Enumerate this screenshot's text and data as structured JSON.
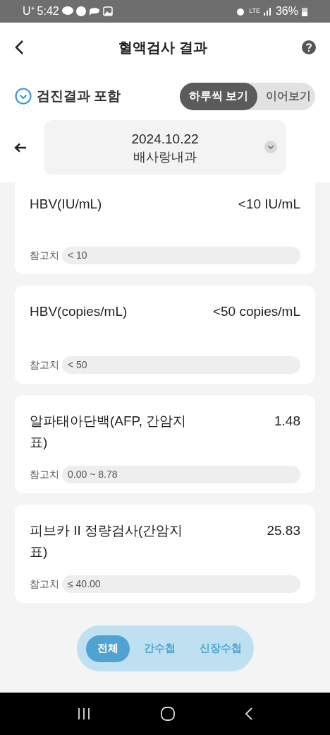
{
  "status_bar": {
    "carrier": "U⁺",
    "time": "5:42",
    "network": "LTE",
    "battery": "36%"
  },
  "header": {
    "title": "혈액검사 결과"
  },
  "include_checkup": {
    "label": "검진결과 포함",
    "checked": true
  },
  "view_modes": [
    {
      "label": "하루씩 보기",
      "selected": true
    },
    {
      "label": "이어보기",
      "selected": false
    }
  ],
  "date_selector": {
    "date": "2024.10.22",
    "department": "배사랑내과"
  },
  "results": [
    {
      "name": "HBV(IU/mL)",
      "value": "<10 IU/mL",
      "reference_label": "참고치",
      "reference": "< 10"
    },
    {
      "name": "HBV(copies/mL)",
      "value": "<50 copies/mL",
      "reference_label": "참고치",
      "reference": "< 50"
    },
    {
      "name": "알파태아단백(AFP, 간암지표)",
      "value": "1.48",
      "reference_label": "참고치",
      "reference": "0.00 ~ 8.78"
    },
    {
      "name": "피브카 II 정량검사(간암지표)",
      "value": "25.83",
      "reference_label": "참고치",
      "reference": "≤ 40.00"
    }
  ],
  "filters": [
    {
      "label": "전체",
      "selected": true
    },
    {
      "label": "간수첩",
      "selected": false
    },
    {
      "label": "신장수첩",
      "selected": false
    }
  ]
}
